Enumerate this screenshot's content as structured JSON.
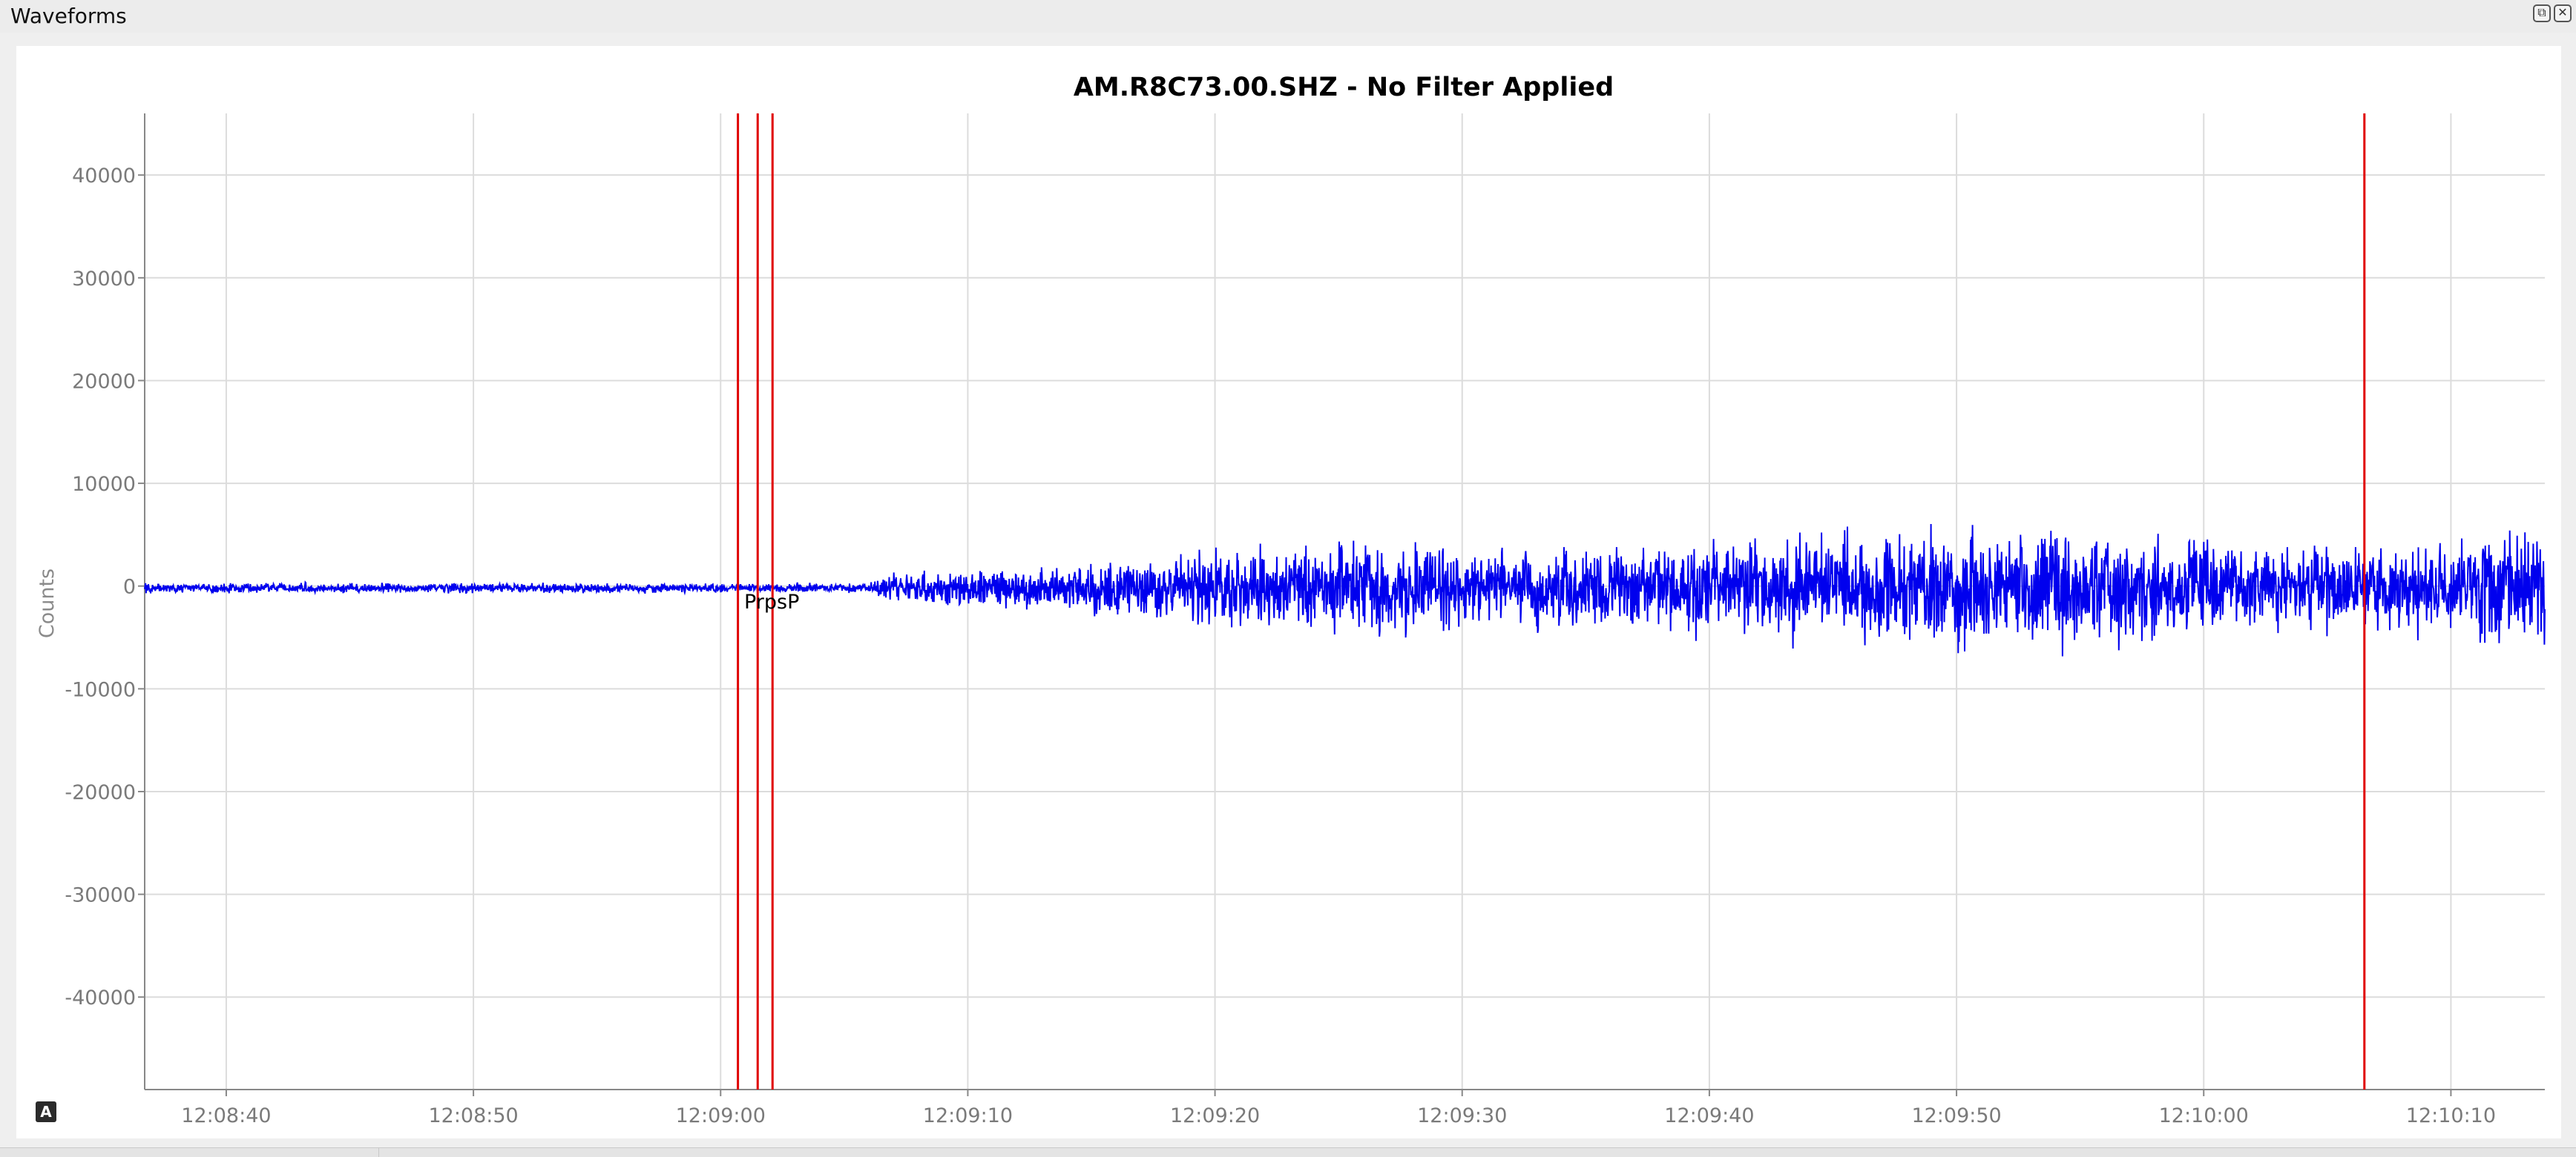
{
  "window": {
    "title": "Waveforms",
    "buttons": [
      {
        "name": "float-window-button",
        "glyph": "⧉"
      },
      {
        "name": "close-window-button",
        "glyph": "✕"
      }
    ]
  },
  "toggle_badge": "A",
  "colors": {
    "waveform": "#0000ee",
    "pick_lines": "#e00000",
    "grid": "#dcdcdc",
    "axis": "#888888"
  },
  "chart_data": {
    "type": "line",
    "title": "AM.R8C73.00.SHZ - No Filter Applied",
    "ylabel": "Counts",
    "xlabel": "",
    "xlim": [
      "12:08:36.7",
      "12:10:13.8"
    ],
    "ylim": [
      -49000,
      46000
    ],
    "grid": true,
    "x_ticks": [
      "12:08:40",
      "12:08:50",
      "12:09:00",
      "12:09:10",
      "12:09:20",
      "12:09:30",
      "12:09:40",
      "12:09:50",
      "12:10:00",
      "12:10:10"
    ],
    "y_ticks": [
      40000,
      30000,
      20000,
      10000,
      0,
      -10000,
      -20000,
      -30000,
      -40000
    ],
    "series": [
      {
        "x_start": "12:08:36.7",
        "x_end": "12:10:13.8",
        "envelope": [
          {
            "t": "12:08:36.7",
            "amp": 500
          },
          {
            "t": "12:09:06.0",
            "amp": 500
          },
          {
            "t": "12:09:07.0",
            "amp": 1500
          },
          {
            "t": "12:09:13.0",
            "amp": 2000
          },
          {
            "t": "12:09:19.0",
            "amp": 3500
          },
          {
            "t": "12:09:25.0",
            "amp": 4500
          },
          {
            "t": "12:09:35.0",
            "amp": 4000
          },
          {
            "t": "12:09:42.0",
            "amp": 5000
          },
          {
            "t": "12:09:48.0",
            "amp": 6000
          },
          {
            "t": "12:09:55.0",
            "amp": 5500
          },
          {
            "t": "12:10:03.0",
            "amp": 4000
          },
          {
            "t": "12:10:08.0",
            "amp": 4500
          },
          {
            "t": "12:10:13.8",
            "amp": 6000
          }
        ]
      }
    ],
    "picks": [
      {
        "label": "P",
        "t": "12:09:00.7"
      },
      {
        "label": "pP",
        "t": "12:09:01.5"
      },
      {
        "label": "sP",
        "t": "12:09:02.1"
      },
      {
        "label": "",
        "t": "12:10:06.5"
      }
    ],
    "pick_text": "PrpsP"
  }
}
